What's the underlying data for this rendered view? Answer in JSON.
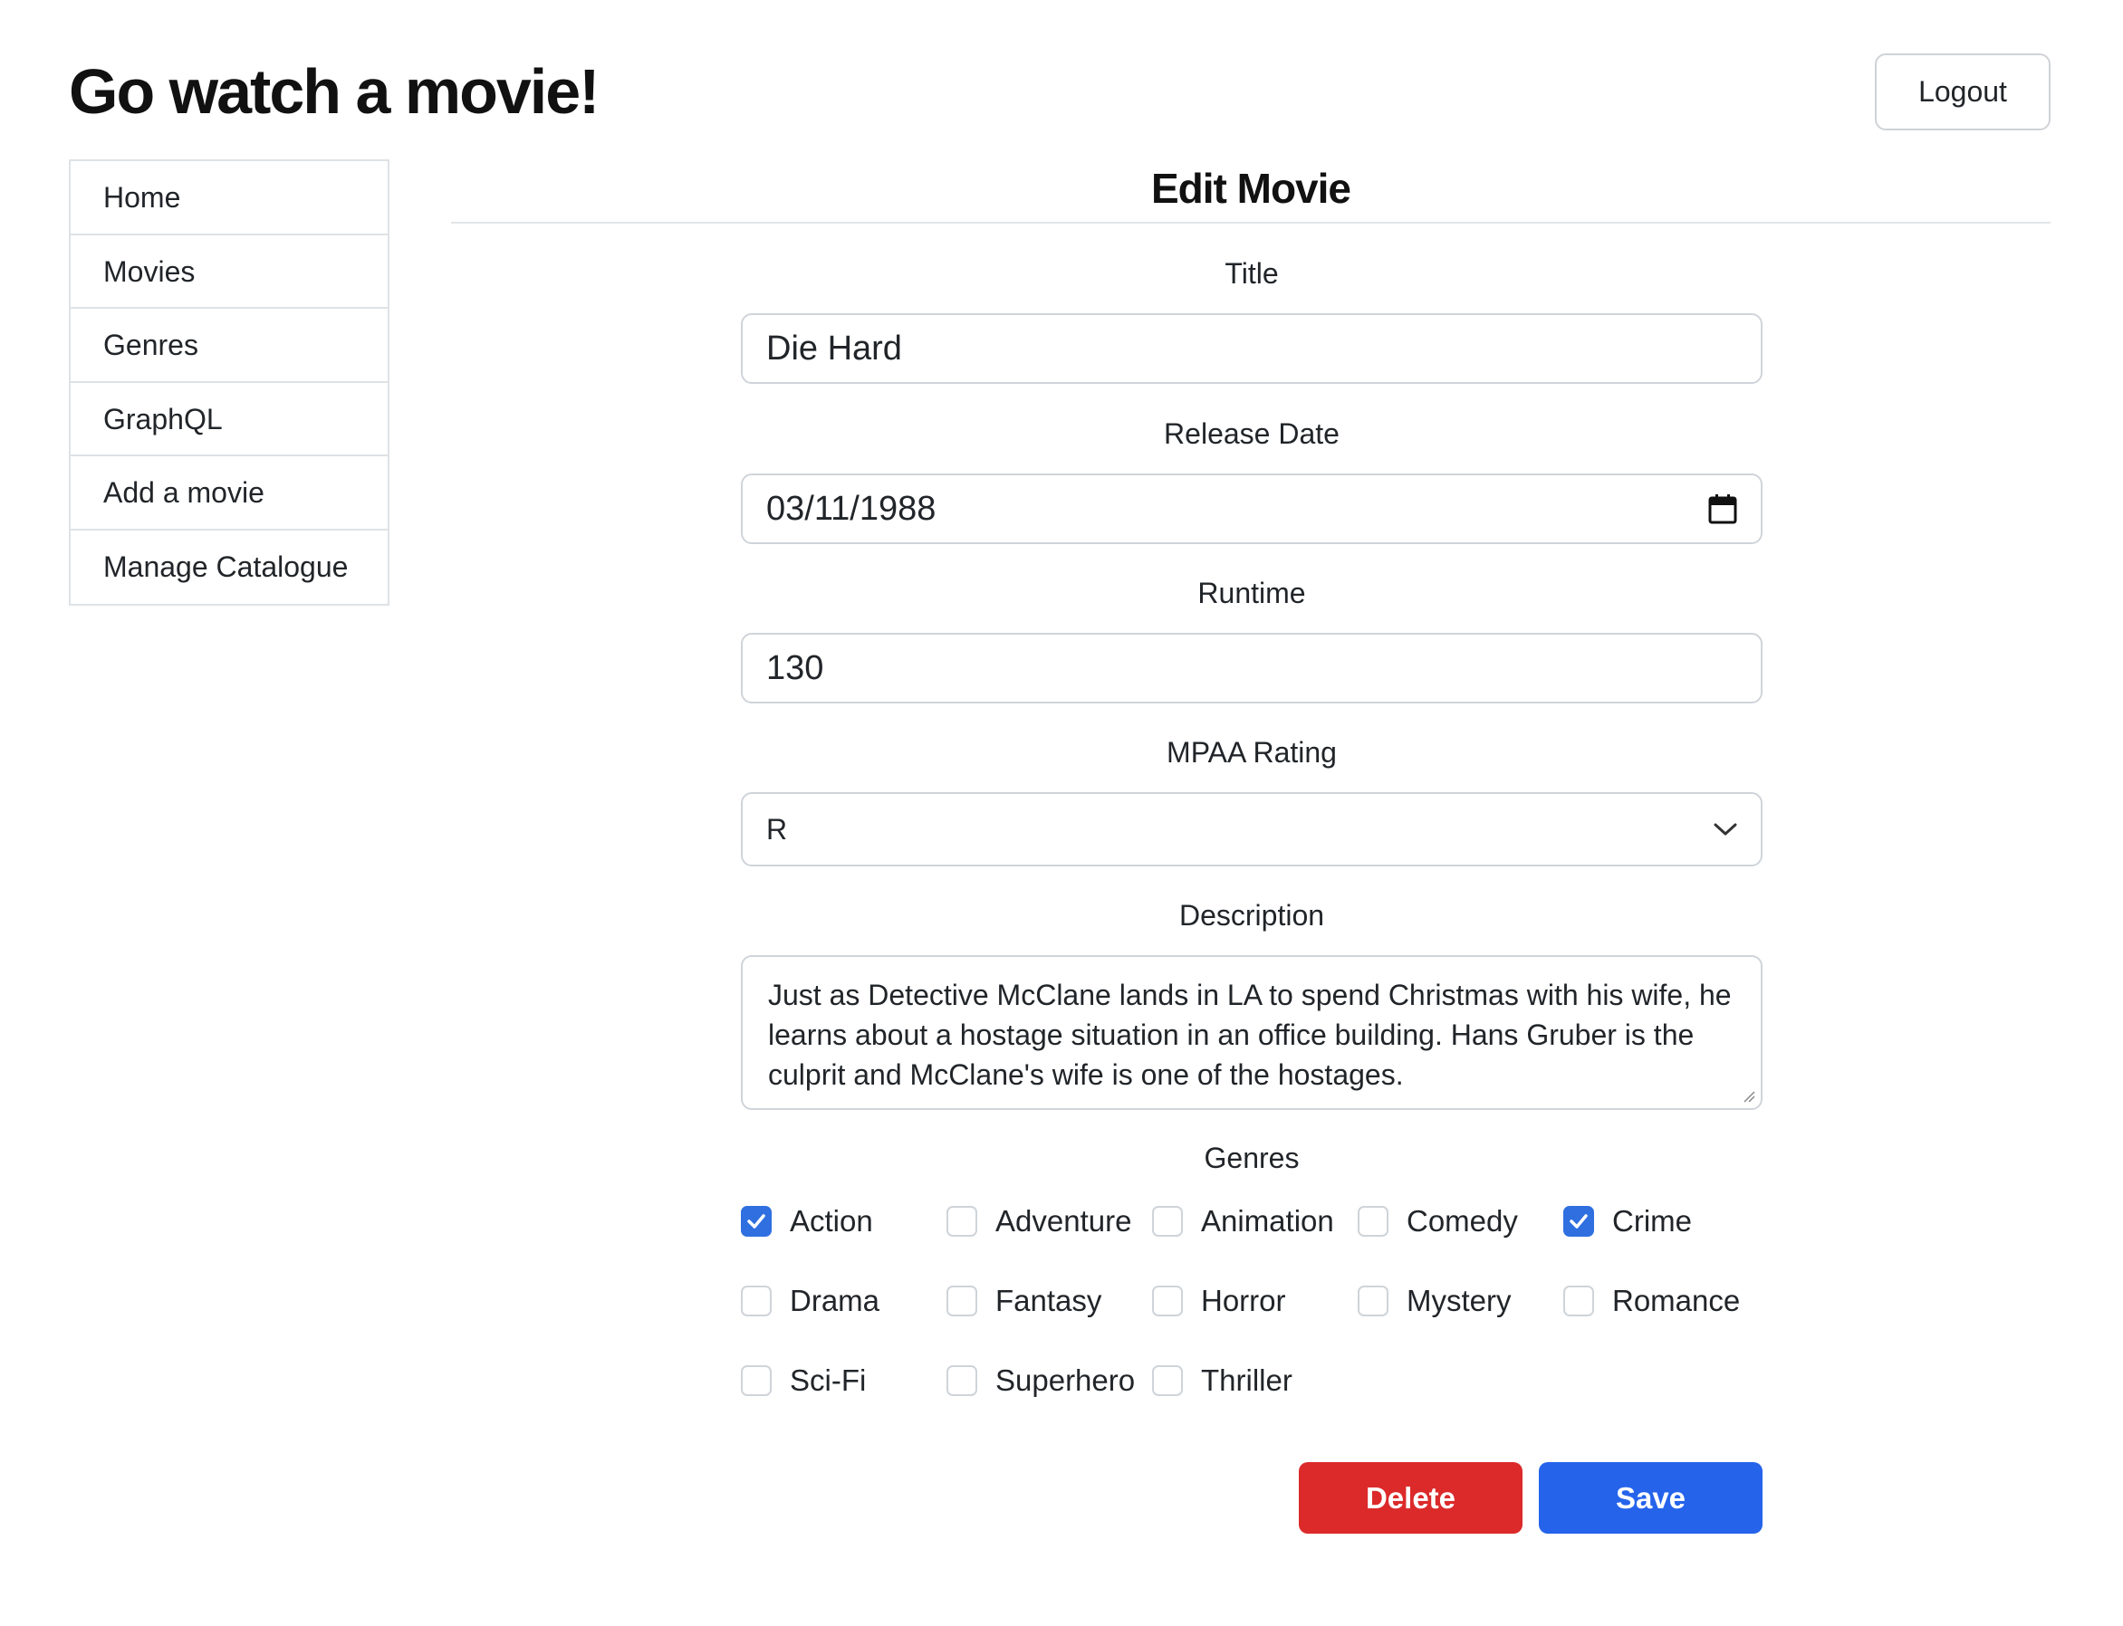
{
  "header": {
    "title": "Go watch a movie!",
    "logout_label": "Logout"
  },
  "sidebar": {
    "items": [
      {
        "label": "Home"
      },
      {
        "label": "Movies"
      },
      {
        "label": "Genres"
      },
      {
        "label": "GraphQL"
      },
      {
        "label": "Add a movie"
      },
      {
        "label": "Manage Catalogue"
      }
    ]
  },
  "form": {
    "heading": "Edit Movie",
    "title_label": "Title",
    "title_value": "Die Hard",
    "release_label": "Release Date",
    "release_value": "03/11/1988",
    "runtime_label": "Runtime",
    "runtime_value": "130",
    "rating_label": "MPAA Rating",
    "rating_value": "R",
    "description_label": "Description",
    "description_value": "Just as Detective McClane lands in LA to spend Christmas with his wife, he learns about a hostage situation in an office building. Hans Gruber is the culprit and McClane's wife is one of the hostages.",
    "genres_label": "Genres",
    "genres": [
      {
        "label": "Action",
        "checked": true
      },
      {
        "label": "Adventure",
        "checked": false
      },
      {
        "label": "Animation",
        "checked": false
      },
      {
        "label": "Comedy",
        "checked": false
      },
      {
        "label": "Crime",
        "checked": true
      },
      {
        "label": "Drama",
        "checked": false
      },
      {
        "label": "Fantasy",
        "checked": false
      },
      {
        "label": "Horror",
        "checked": false
      },
      {
        "label": "Mystery",
        "checked": false
      },
      {
        "label": "Romance",
        "checked": false
      },
      {
        "label": "Sci-Fi",
        "checked": false
      },
      {
        "label": "Superhero",
        "checked": false
      },
      {
        "label": "Thriller",
        "checked": false
      }
    ],
    "delete_label": "Delete",
    "save_label": "Save"
  },
  "icons": {
    "calendar": "calendar-icon",
    "chevron": "chevron-down-icon",
    "check": "checkmark-icon"
  },
  "colors": {
    "checkbox_checked": "#2f6fe0",
    "delete_button": "#dc2a2a",
    "save_button": "#2563eb"
  }
}
